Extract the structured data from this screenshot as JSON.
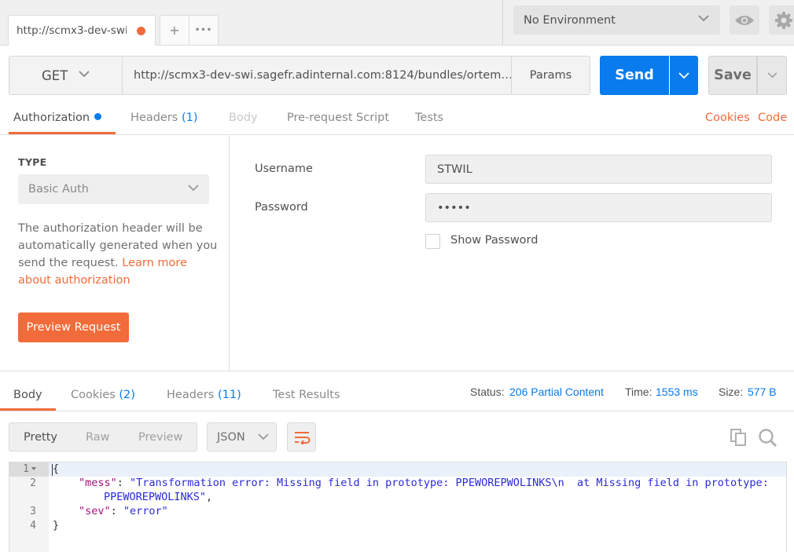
{
  "tabs": {
    "active_title": "http://scmx3-dev-swi.s",
    "plus_glyph": "+",
    "more_glyph": "•••"
  },
  "environment": {
    "selected": "No Environment"
  },
  "request": {
    "method": "GET",
    "url": "http://scmx3-dev-swi.sagefr.adinternal.com:8124/bundles/ortem…",
    "params_label": "Params",
    "send_label": "Send",
    "save_label": "Save"
  },
  "request_tabs": {
    "authorization": "Authorization",
    "headers": "Headers",
    "headers_count": "(1)",
    "body": "Body",
    "pre_request": "Pre-request Script",
    "tests": "Tests",
    "cookies": "Cookies",
    "code": "Code"
  },
  "auth": {
    "type_label": "TYPE",
    "type_value": "Basic Auth",
    "description": "The authorization header will be automatically generated when you send the request.",
    "learn_more": "Learn more about authorization",
    "preview_label": "Preview Request",
    "username_label": "Username",
    "username_value": "STWIL",
    "password_label": "Password",
    "password_value": "•••••",
    "show_password_label": "Show Password"
  },
  "response_tabs": {
    "body": "Body",
    "cookies": "Cookies",
    "cookies_count": "(2)",
    "headers": "Headers",
    "headers_count": "(11)",
    "test_results": "Test Results"
  },
  "response_meta": {
    "status_label": "Status:",
    "status_value": "206 Partial Content",
    "time_label": "Time:",
    "time_value": "1553 ms",
    "size_label": "Size:",
    "size_value": "577 B"
  },
  "response_view": {
    "pretty": "Pretty",
    "raw": "Raw",
    "preview": "Preview",
    "format": "JSON"
  },
  "code_lines": {
    "l1": "1",
    "l2": "2",
    "l3": "3",
    "l4": "4",
    "open_brace": "{",
    "mess_key": "\"mess\"",
    "colon": ": ",
    "mess_value_part1": "\"Transformation error: Missing field in prototype: PPEWOREPWOLINKS\\n  at Missing field in prototype:",
    "mess_value_part2": "PPEWOREPWOLINKS\"",
    "comma": ",",
    "sev_key": "\"sev\"",
    "sev_value": "\"error\"",
    "close_brace": "}"
  },
  "colors": {
    "accent_orange": "#f26b3a",
    "accent_blue": "#097bed"
  },
  "icons": [
    "chevron-down-icon",
    "eye-icon",
    "gear-icon",
    "wrap-lines-icon",
    "copy-icon",
    "search-icon"
  ]
}
